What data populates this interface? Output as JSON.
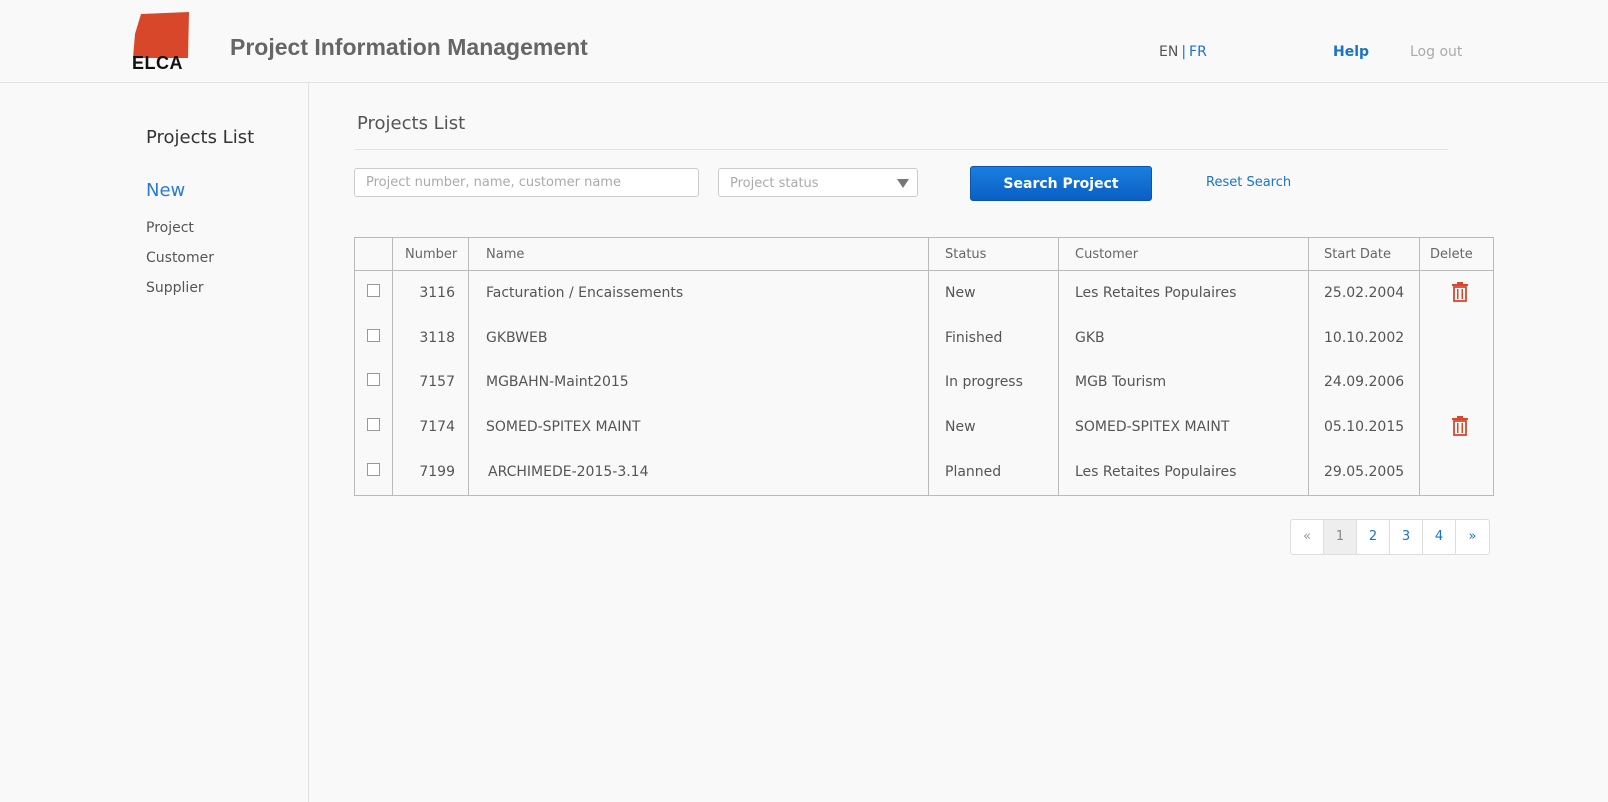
{
  "header": {
    "logo_text": "ELCA",
    "app_title": "Project Information Management",
    "lang_en": "EN",
    "lang_sep": "|",
    "lang_fr": "FR",
    "help": "Help",
    "logout": "Log out"
  },
  "sidebar": {
    "title": "Projects List",
    "new_label": "New",
    "items": [
      {
        "label": "Project"
      },
      {
        "label": "Customer"
      },
      {
        "label": "Supplier"
      }
    ]
  },
  "main": {
    "title": "Projects List",
    "search_placeholder": "Project number, name, customer name",
    "status_placeholder": "Project status",
    "search_button": "Search Project",
    "reset_link": "Reset Search"
  },
  "table": {
    "columns": [
      "Number",
      "Name",
      "Status",
      "Customer",
      "Start Date",
      "Delete"
    ],
    "rows": [
      {
        "number": "3116",
        "name": "Facturation / Encaissements",
        "status": "New",
        "customer": "Les Retaites Populaires",
        "start_date": "25.02.2004",
        "deletable": true
      },
      {
        "number": "3118",
        "name": "GKBWEB",
        "status": "Finished",
        "customer": "GKB",
        "start_date": "10.10.2002",
        "deletable": false
      },
      {
        "number": "7157",
        "name": "MGBAHN-Maint2015",
        "status": "In progress",
        "customer": "MGB Tourism",
        "start_date": "24.09.2006",
        "deletable": false
      },
      {
        "number": "7174",
        "name": "SOMED-SPITEX MAINT",
        "status": "New",
        "customer": "SOMED-SPITEX MAINT",
        "start_date": "05.10.2015",
        "deletable": true
      },
      {
        "number": "7199",
        "name": "ARCHIMEDE-2015-3.14",
        "status": "Planned",
        "customer": "Les Retaites Populaires",
        "start_date": "29.05.2005",
        "deletable": false
      }
    ]
  },
  "pagination": {
    "prev": "«",
    "pages": [
      "1",
      "2",
      "3",
      "4"
    ],
    "current": "1",
    "next": "»"
  },
  "colors": {
    "accent": "#1a73c9",
    "button": "#0a5fc4",
    "delete": "#d9472b",
    "logo": "#d9472b"
  }
}
